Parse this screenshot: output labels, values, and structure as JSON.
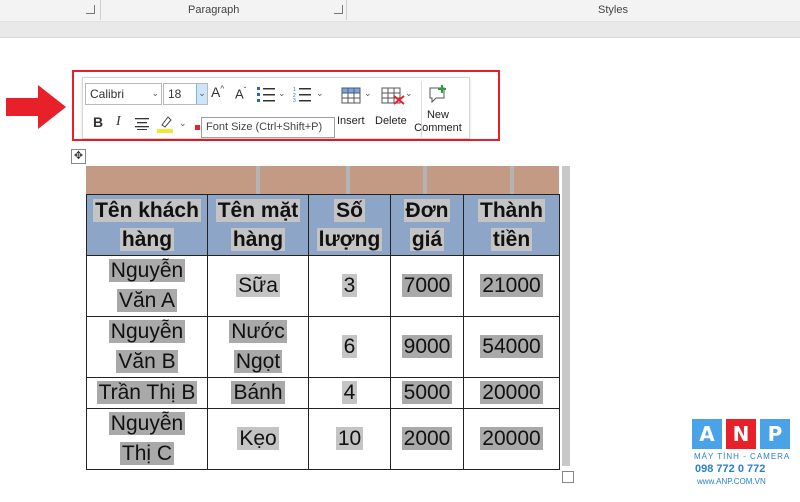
{
  "ribbon": {
    "paragraph_label": "Paragraph",
    "styles_label": "Styles"
  },
  "mini_toolbar": {
    "font_name": "Calibri",
    "font_size": "18",
    "grow_font": "A",
    "shrink_font": "A",
    "bold": "B",
    "italic": "I",
    "insert_label": "Insert",
    "delete_label": "Delete",
    "new_comment_label_line1": "New",
    "new_comment_label_line2": "Comment",
    "tooltip": "Font Size (Ctrl+Shift+P)"
  },
  "table": {
    "headers": [
      [
        "Tên khách",
        "hàng"
      ],
      [
        "Tên mặt",
        "hàng"
      ],
      [
        "Số",
        "lượng"
      ],
      [
        "Đơn",
        "giá"
      ],
      [
        "Thành",
        "tiền"
      ]
    ],
    "rows": [
      {
        "customer": [
          "Nguyễn",
          "Văn A"
        ],
        "product": [
          "Sữa"
        ],
        "qty": "3",
        "price": "7000",
        "total": "21000"
      },
      {
        "customer": [
          "Nguyễn",
          "Văn B"
        ],
        "product": [
          "Nước",
          "Ngọt"
        ],
        "qty": "6",
        "price": "9000",
        "total": "54000"
      },
      {
        "customer": [
          "Trần Thị B"
        ],
        "product": [
          "Bánh"
        ],
        "qty": "4",
        "price": "5000",
        "total": "20000"
      },
      {
        "customer": [
          "Nguyễn",
          "Thị C"
        ],
        "product": [
          "Kẹo"
        ],
        "qty": "10",
        "price": "2000",
        "total": "20000"
      }
    ]
  },
  "logo": {
    "letters": [
      "A",
      "N",
      "P"
    ],
    "tagline": "MÁY TÍNH - CAMERA",
    "phone": "098 772 0 772",
    "website": "www.ANP.COM.VN",
    "colors": [
      "#4aa3e6",
      "#e8202a",
      "#4aa3e6"
    ]
  },
  "colors": {
    "highlight_border": "#e8202a",
    "header_fill": "#8da5c6",
    "selected_row_fill": "#c39a84",
    "arrow": "#e8202a"
  }
}
